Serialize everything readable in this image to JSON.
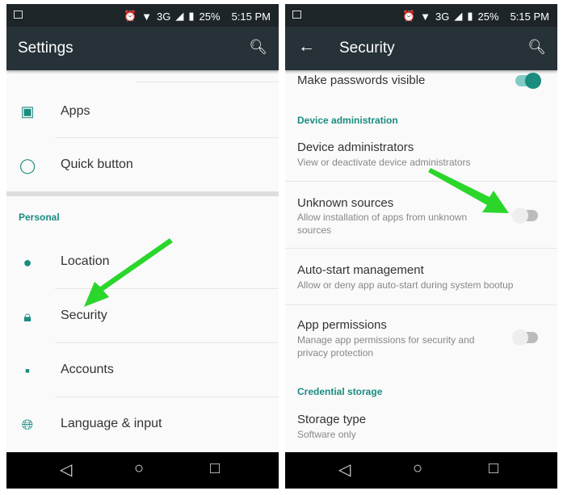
{
  "status": {
    "battery": "25%",
    "time": "5:15 PM",
    "network": "3G"
  },
  "left": {
    "title": "Settings",
    "items": [
      {
        "label": "Apps",
        "icon": "android-icon"
      },
      {
        "label": "Quick button",
        "icon": "quick-button-icon"
      }
    ],
    "section": "Personal",
    "personal": [
      {
        "label": "Location",
        "icon": "location-pin-icon"
      },
      {
        "label": "Security",
        "icon": "lock-icon"
      },
      {
        "label": "Accounts",
        "icon": "account-icon"
      },
      {
        "label": "Language & input",
        "icon": "globe-icon"
      }
    ]
  },
  "right": {
    "title": "Security",
    "make_passwords": {
      "label": "Make passwords visible",
      "enabled": true
    },
    "section_device": "Device administration",
    "device_admins": {
      "label": "Device administrators",
      "sub": "View or deactivate device administrators"
    },
    "unknown": {
      "label": "Unknown sources",
      "sub1": "Allow installation of apps from unknown",
      "sub2": "sources",
      "enabled": false
    },
    "autostart": {
      "label": "Auto-start management",
      "sub": "Allow or deny app auto-start during system bootup"
    },
    "permissions": {
      "label": "App permissions",
      "sub1": "Manage app permissions for security and",
      "sub2": "privacy protection",
      "enabled": false
    },
    "section_cred": "Credential storage",
    "storage": {
      "label": "Storage type",
      "sub": "Software only"
    }
  },
  "colors": {
    "accent": "#1a8c80",
    "toolbar": "#263238",
    "arrow": "#2bd62b"
  }
}
